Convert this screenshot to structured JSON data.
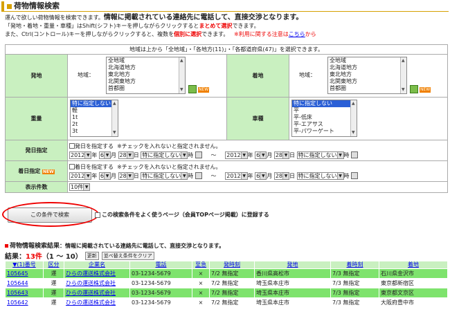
{
  "page": {
    "title": "荷物情報検索",
    "intro_1_pre": "運んで欲しい荷物情報を検索できます。",
    "intro_1_big": "情報に掲載されている連絡先に電話して、直接交渉となります。",
    "intro_2_pre": "「発地・着地・重量・車種」はShift(シフト)キーを押しながらクリックすると",
    "intro_2_red": "まとめて選択",
    "intro_2_post": "できます。",
    "intro_3_pre": "また、Ctrl(コントロール)キーを押しながらクリックすると、複数を",
    "intro_3_red": "個別に選択",
    "intro_3_mid": "できます。",
    "intro_3_note": "※利用に関する注意は",
    "intro_3_link": "こちら",
    "intro_3_end": "から"
  },
  "form": {
    "summary": "地域は上から「全地域」・「各地方(11)」・「各都道府県(47)」を選択できます。",
    "origin_label": "発地",
    "dest_label": "着地",
    "region_label": "地域：",
    "regions": [
      "全地域",
      "北海道地方",
      "東北地方",
      "北関東地方",
      "首都圏"
    ],
    "weight_label": "重量",
    "weights": [
      "特に指定しない",
      "軽",
      "1t",
      "2t",
      "3t"
    ],
    "vehicle_label": "車種",
    "vehicles": [
      "特に指定しない",
      "平",
      "平-低床",
      "平-エアサス",
      "平-パワーゲート"
    ],
    "new_badge": "NEW",
    "dep_label": "発日指定",
    "arr_label": "着日指定",
    "dep_check": "発日を指定する",
    "arr_check": "着日を指定する",
    "date_note": "※チェックを入れないと指定されません。",
    "year": "2012",
    "month": "6",
    "day": "28",
    "year_u": "年",
    "month_u": "月",
    "day_u": "日",
    "hour_sel": "特に指定しない",
    "hour_u": "時",
    "tilde": "～",
    "count_label": "表示件数",
    "count_value": "10件"
  },
  "actions": {
    "search": "この条件で検索",
    "save_check": "この検索条件をよく使うページ（会員TOPページ掲載）に登録する"
  },
  "results": {
    "heading": "荷物情報検索結果",
    "heading_sub": "：情報に掲載されている連絡先に電話して、直接交渉となります。",
    "count_pre": "結果：",
    "count_num": "13件",
    "count_range": "（1 ～ 10）",
    "refresh": "更新",
    "clear_sort": "並べ替え条件をクリア",
    "columns": [
      "▼(1)番号",
      "区分",
      "企業名",
      "電話",
      "至急",
      "発時刻",
      "発地",
      "着時刻",
      "着地"
    ],
    "rows": [
      {
        "id": "105645",
        "kubun": "運",
        "company": "ひらの運送株式会社",
        "tel": "03-1234-5679",
        "urgent": "×",
        "dep": "7/2 無指定",
        "from": "香川県高松市",
        "arr": "7/3 無指定",
        "to": "石川県金沢市"
      },
      {
        "id": "105644",
        "kubun": "運",
        "company": "ひらの運送株式会社",
        "tel": "03-1234-5679",
        "urgent": "×",
        "dep": "7/2 無指定",
        "from": "埼玉県本庄市",
        "arr": "7/3 無指定",
        "to": "東京都新宿区"
      },
      {
        "id": "105643",
        "kubun": "運",
        "company": "ひらの運送株式会社",
        "tel": "03-1234-5679",
        "urgent": "×",
        "dep": "7/2 無指定",
        "from": "埼玉県本庄市",
        "arr": "7/3 無指定",
        "to": "東京都文京区"
      },
      {
        "id": "105642",
        "kubun": "運",
        "company": "ひらの運送株式会社",
        "tel": "03-1234-5679",
        "urgent": "×",
        "dep": "7/2 無指定",
        "from": "埼玉県本庄市",
        "arr": "7/3 無指定",
        "to": "大阪府豊中市"
      }
    ]
  },
  "colors": {
    "accent": "#d6a000",
    "label_bg": "#c9f0c0",
    "row_green": "#7ee36d",
    "highlight": "#e00000"
  }
}
